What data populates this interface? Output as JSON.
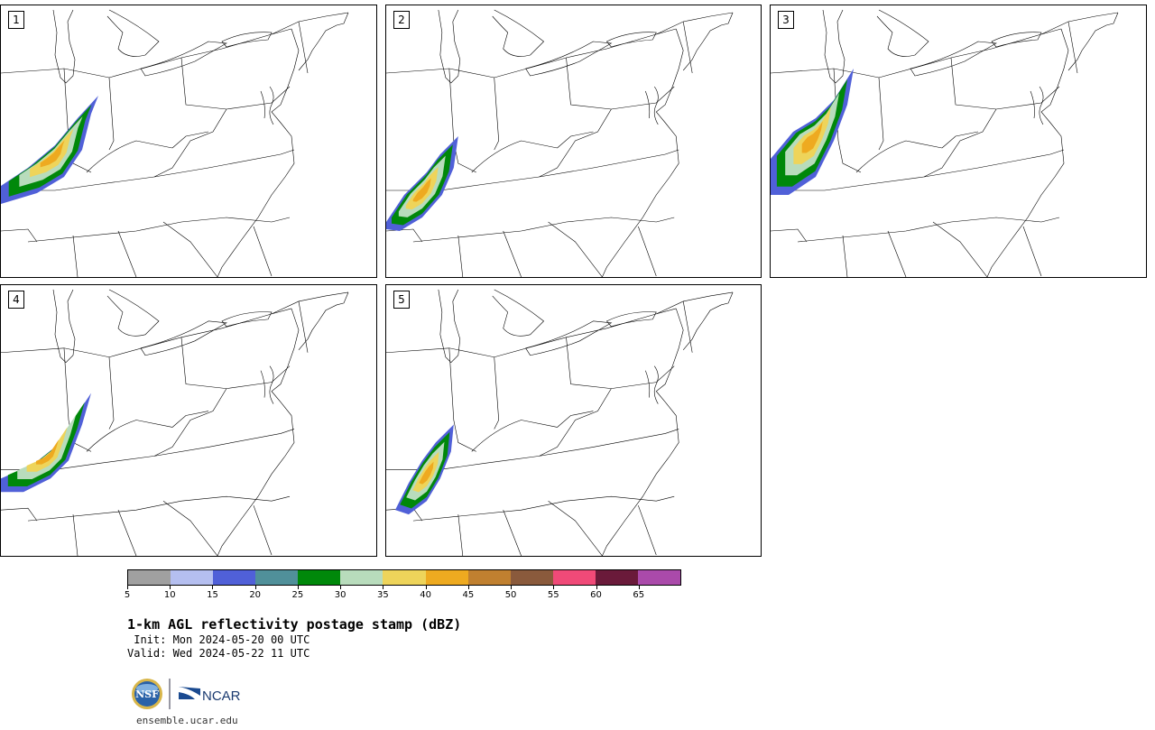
{
  "panels": [
    {
      "label": "1"
    },
    {
      "label": "2"
    },
    {
      "label": "3"
    },
    {
      "label": "4"
    },
    {
      "label": "5"
    }
  ],
  "colorbar": {
    "colors": [
      "#a0a0a0",
      "#b5bff0",
      "#5060d8",
      "#50909a",
      "#00880a",
      "#b8dcbc",
      "#eed45a",
      "#eeaa20",
      "#c08030",
      "#8a5a3c",
      "#f04a78",
      "#6a1a3a",
      "#aa4aaa"
    ],
    "tick_labels": [
      "5",
      "10",
      "15",
      "20",
      "25",
      "30",
      "35",
      "40",
      "45",
      "50",
      "55",
      "60",
      "65"
    ]
  },
  "title": "1-km AGL reflectivity postage stamp (dBZ)",
  "init": " Init: Mon 2024-05-20 00 UTC",
  "valid": "Valid: Wed 2024-05-22 11 UTC",
  "logos": {
    "nsf": "NSF",
    "ncar": "NCAR"
  },
  "site": "ensemble.ucar.edu"
}
